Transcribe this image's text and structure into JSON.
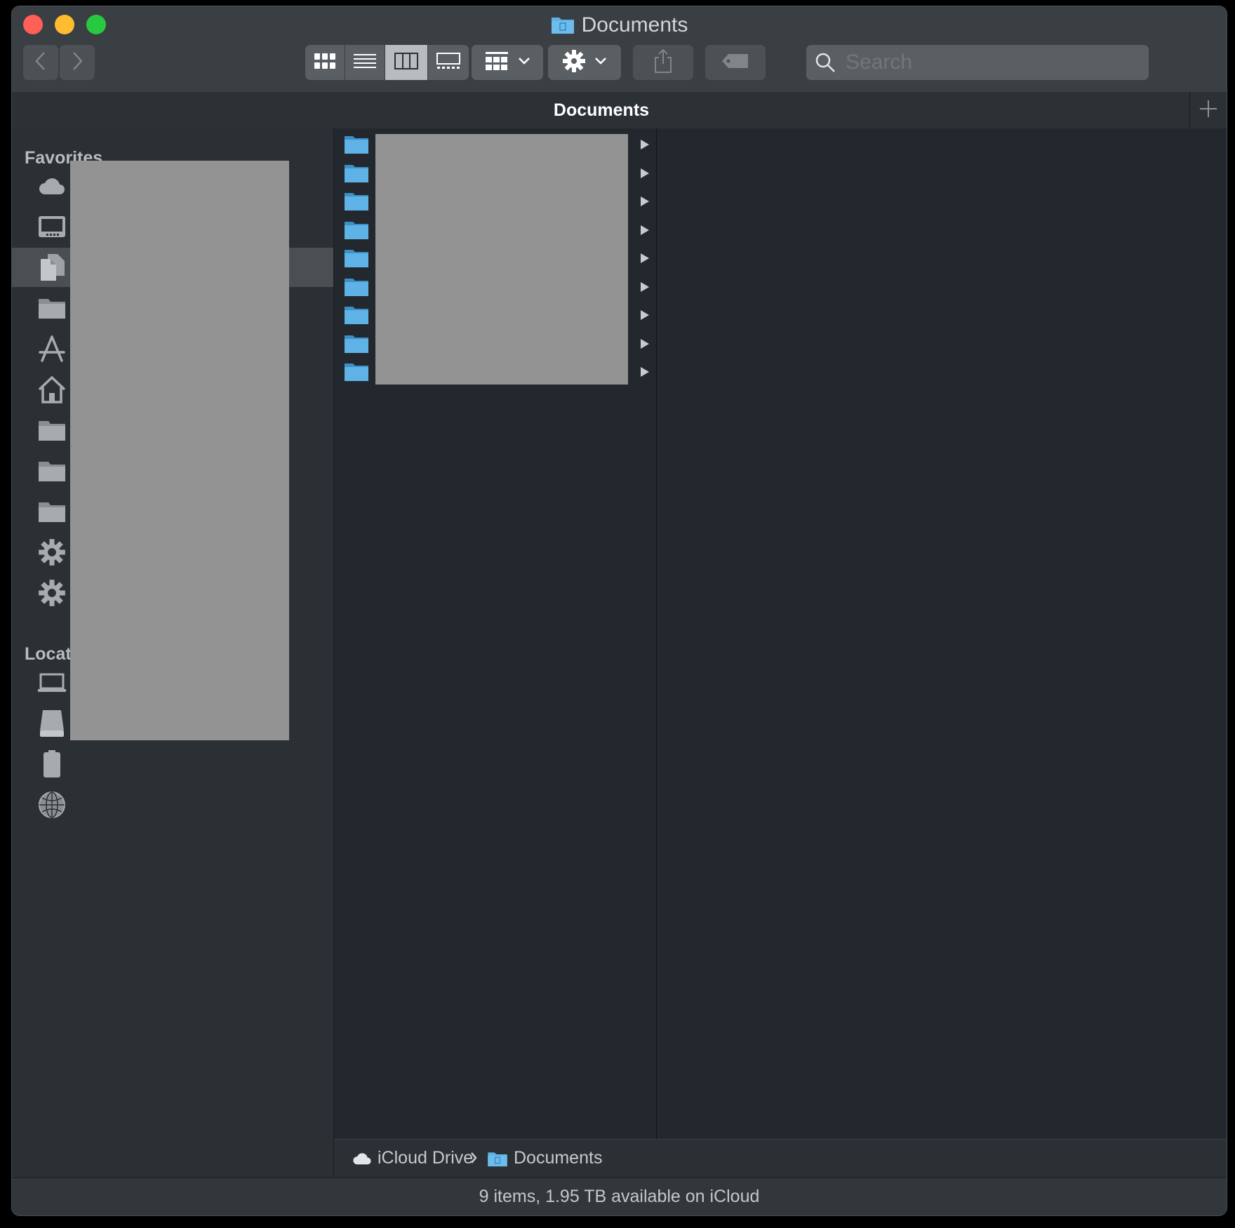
{
  "window": {
    "title": "Documents",
    "traffic_lights": {
      "close": "#fe5f57",
      "minimize": "#febc2e",
      "zoom": "#28c840"
    }
  },
  "toolbar": {
    "back_icon": "chevron-left-icon",
    "forward_icon": "chevron-right-icon",
    "view_modes": [
      "icon-view",
      "list-view",
      "column-view",
      "gallery-view"
    ],
    "selected_view": "column-view",
    "group_icon": "group-by-icon",
    "action_icon": "gear-icon",
    "share_icon": "share-icon",
    "tag_icon": "tag-icon",
    "search_placeholder": "Search"
  },
  "tabbar": {
    "title": "Documents"
  },
  "sidebar": {
    "favorites_header": "Favorites",
    "favorites_icons": [
      "icloud-icon",
      "desktop-icon",
      "documents-icon",
      "folder-icon",
      "applications-icon",
      "home-icon",
      "folder-icon",
      "folder-icon",
      "folder-icon",
      "gear-icon",
      "gear-icon"
    ],
    "selected_index": 2,
    "locations_header": "Locati",
    "locations_icons": [
      "laptop-icon",
      "disk-icon",
      "device-icon",
      "network-icon"
    ]
  },
  "column1": {
    "folder_count": 9
  },
  "pathbar": {
    "items": [
      "iCloud Drive",
      "Documents"
    ]
  },
  "statusbar": {
    "text": "9 items, 1.95 TB available on iCloud"
  },
  "colors": {
    "folder_blue": "#5fb2e6",
    "window_bg": "#22282d",
    "sidebar_bg": "#2b3035",
    "redaction": "#939393"
  }
}
